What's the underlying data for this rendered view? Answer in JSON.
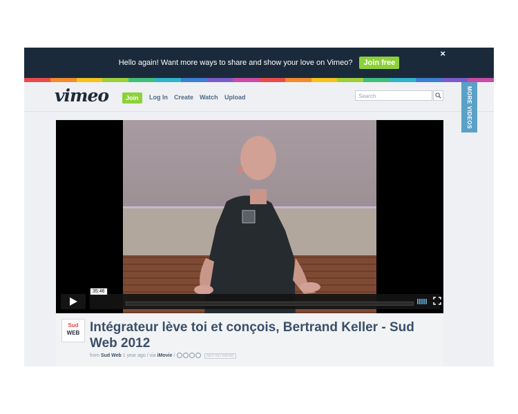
{
  "banner": {
    "message": "Hello again! Want more ways to share and show your love on Vimeo?",
    "cta_label": "Join free",
    "close_glyph": "×",
    "stripe_colors": [
      "#e84b4b",
      "#f28b2a",
      "#f6c21a",
      "#9ccf3a",
      "#3fbf7a",
      "#2fb4c8",
      "#3b7fd1",
      "#7a5cc9",
      "#c84ba7",
      "#e84b4b",
      "#f28b2a",
      "#f6c21a",
      "#9ccf3a",
      "#3fbf7a",
      "#2fb4c8",
      "#3b7fd1",
      "#7a5cc9",
      "#c84ba7"
    ]
  },
  "header": {
    "logo_text": "vimeo",
    "nav": {
      "join": "Join",
      "login": "Log In",
      "create": "Create",
      "watch": "Watch",
      "upload": "Upload"
    },
    "search_placeholder": "Search"
  },
  "more_videos_label": "MORE VIDEOS",
  "player": {
    "duration": "35:46",
    "play_icon": "play-icon",
    "fullscreen_icon": "fullscreen-icon",
    "volume_icon": "volume-icon",
    "progress_fraction": 0
  },
  "video": {
    "title": "Intégrateur lève toi et conçois, Bertrand Keller - Sud Web 2012",
    "from_label": "from",
    "channel": "Sud Web",
    "age": "1 year ago",
    "via_label": "/ via",
    "via_app": "iMovie",
    "rating": "NOT YET RATED",
    "channel_logo": {
      "line1": "Sud",
      "line2": "WEB"
    }
  },
  "colors": {
    "banner_bg": "#1b2a3b",
    "accent_green": "#8dd13a",
    "more_videos_bg": "#5ba1c7",
    "title_color": "#3a4f69"
  }
}
